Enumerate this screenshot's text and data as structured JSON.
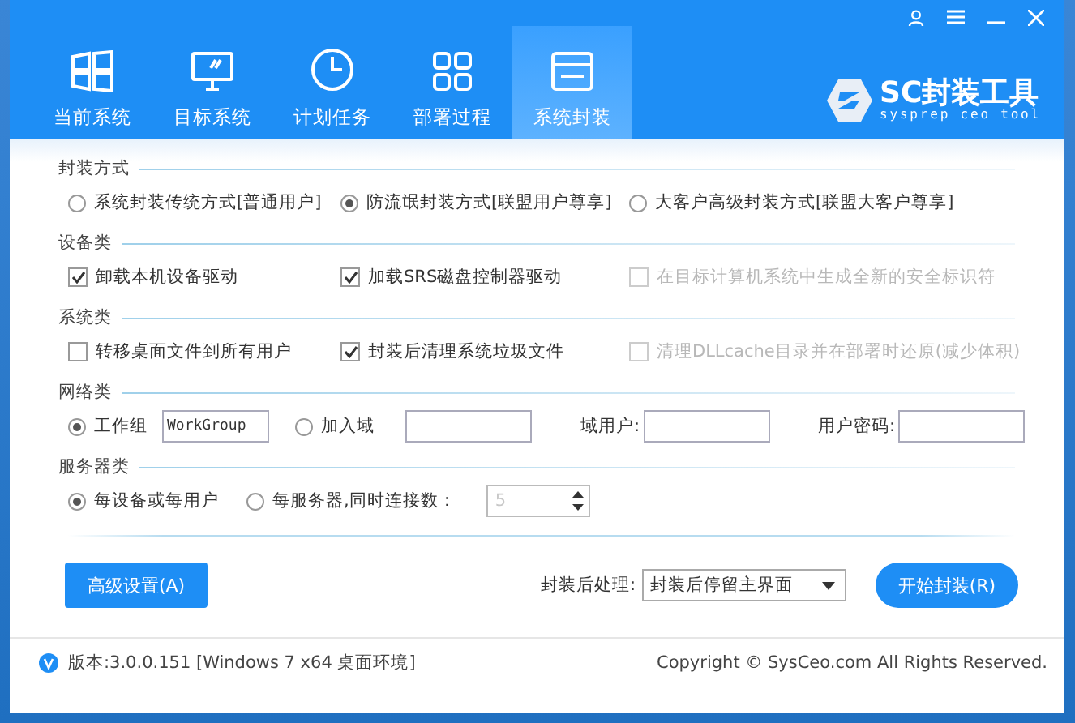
{
  "tabs": [
    {
      "label": "当前系统",
      "selected": false
    },
    {
      "label": "目标系统",
      "selected": false
    },
    {
      "label": "计划任务",
      "selected": false
    },
    {
      "label": "部署过程",
      "selected": false
    },
    {
      "label": "系统封装",
      "selected": true
    }
  ],
  "logo": {
    "name": "SC封装工具",
    "tagline": "sysprep ceo tool"
  },
  "sections": [
    {
      "title": "封装方式",
      "items": [
        {
          "kind": "radio",
          "label": "系统封装传统方式[普通用户]",
          "selected": false
        },
        {
          "kind": "radio",
          "label": "防流氓封装方式[联盟用户尊享]",
          "selected": true
        },
        {
          "kind": "radio",
          "label": "大客户高级封装方式[联盟大客户尊享]",
          "selected": false
        }
      ]
    },
    {
      "title": "设备类",
      "items": [
        {
          "kind": "check",
          "label": "卸载本机设备驱动",
          "checked": true,
          "disabled": false
        },
        {
          "kind": "check",
          "label": "加载SRS磁盘控制器驱动",
          "checked": true,
          "disabled": false
        },
        {
          "kind": "check",
          "label": "在目标计算机系统中生成全新的安全标识符",
          "checked": false,
          "disabled": true
        }
      ]
    },
    {
      "title": "系统类",
      "items": [
        {
          "kind": "check",
          "label": "转移桌面文件到所有用户",
          "checked": false,
          "disabled": false
        },
        {
          "kind": "check",
          "label": "封装后清理系统垃圾文件",
          "checked": true,
          "disabled": false
        },
        {
          "kind": "check",
          "label": "清理DLLcache目录并在部署时还原(减少体积)",
          "checked": false,
          "disabled": true
        }
      ]
    },
    {
      "title": "网络类",
      "items": [
        {
          "kind": "radio_with_field",
          "label": "工作组",
          "selected": true,
          "value": "WorkGroup"
        },
        {
          "kind": "radio_with_field",
          "label": "加入域",
          "selected": false
        },
        {
          "kind": "labeled_field",
          "label": "域用户:"
        },
        {
          "kind": "labeled_field",
          "label": "用户密码:"
        }
      ]
    },
    {
      "title": "服务器类",
      "items": [
        {
          "kind": "radio",
          "label": "每设备或每用户",
          "selected": true
        },
        {
          "kind": "radio",
          "label": "每服务器,同时连接数：",
          "selected": false,
          "spinner": {
            "value": "5",
            "disabled": true
          }
        }
      ]
    }
  ],
  "advanced_button": "高级设置(A)",
  "post_process": {
    "label": "封装后处理:",
    "value": "封装后停留主界面"
  },
  "start_button": "开始封装(R)",
  "footer": {
    "version": "版本:3.0.0.151 [Windows 7 x64 桌面环境]",
    "copyright": "Copyright © SysCeo.com All Rights Reserved."
  }
}
